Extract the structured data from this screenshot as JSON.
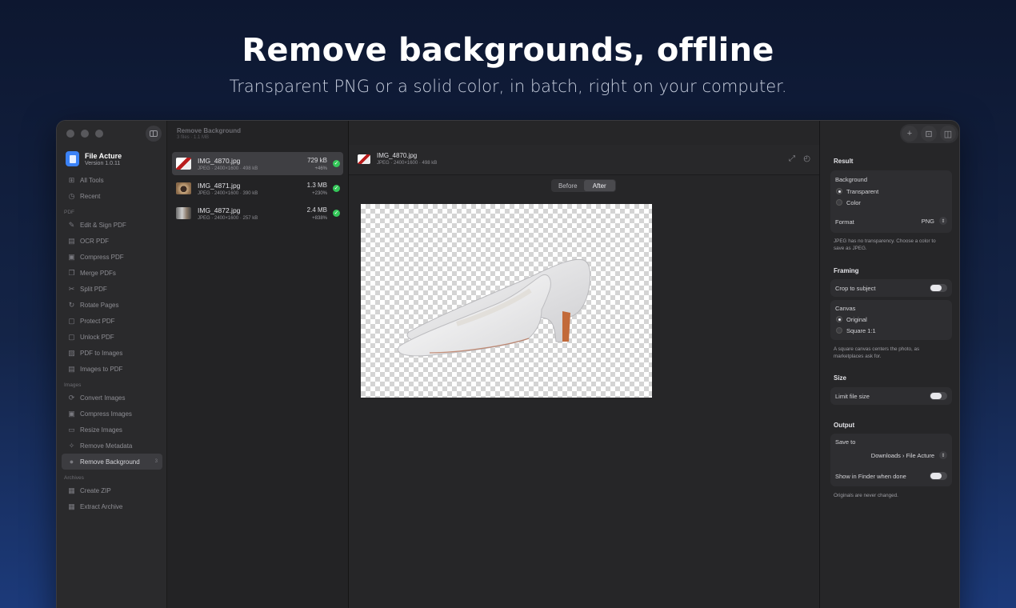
{
  "hero": {
    "title": "Remove backgrounds, offline",
    "subtitle": "Transparent PNG or a solid color, in batch, right on your computer."
  },
  "app": {
    "name": "File Acture",
    "version": "Version 1.0.11"
  },
  "sidebar": {
    "top": [
      {
        "label": "All Tools",
        "icon": "grid-icon"
      },
      {
        "label": "Recent",
        "icon": "clock-icon"
      }
    ],
    "pdf_section": "PDF",
    "pdf": [
      {
        "label": "Edit & Sign PDF"
      },
      {
        "label": "OCR PDF"
      },
      {
        "label": "Compress PDF"
      },
      {
        "label": "Merge PDFs"
      },
      {
        "label": "Split PDF"
      },
      {
        "label": "Rotate Pages"
      },
      {
        "label": "Protect PDF"
      },
      {
        "label": "Unlock PDF"
      },
      {
        "label": "PDF to Images"
      },
      {
        "label": "Images to PDF"
      }
    ],
    "images_section": "Images",
    "images": [
      {
        "label": "Convert Images"
      },
      {
        "label": "Compress Images"
      },
      {
        "label": "Resize Images"
      },
      {
        "label": "Remove Metadata"
      },
      {
        "label": "Remove Background",
        "count": "3"
      }
    ],
    "archives_section": "Archives",
    "archives": [
      {
        "label": "Create ZIP"
      },
      {
        "label": "Extract Archive"
      }
    ]
  },
  "filelist": {
    "title": "Remove Background",
    "subtitle": "3 files · 1.1 MB",
    "files": [
      {
        "name": "IMG_4870.jpg",
        "meta": "JPEG · 2400×1600 · 498 kB",
        "size": "729 kB",
        "delta": "+46%"
      },
      {
        "name": "IMG_4871.jpg",
        "meta": "JPEG · 2400×1600 · 390 kB",
        "size": "1.3 MB",
        "delta": "+230%"
      },
      {
        "name": "IMG_4872.jpg",
        "meta": "JPEG · 2400×1600 · 257 kB",
        "size": "2.4 MB",
        "delta": "+838%"
      }
    ]
  },
  "preview": {
    "name": "IMG_4870.jpg",
    "meta": "JPEG · 2400×1600 · 498 kB",
    "before_label": "Before",
    "after_label": "After",
    "active_tab": "After"
  },
  "inspector": {
    "result_title": "Result",
    "background_label": "Background",
    "bg_transparent": "Transparent",
    "bg_color": "Color",
    "format_label": "Format",
    "format_value": "PNG",
    "format_note": "JPEG has no transparency. Choose a color to save as JPEG.",
    "framing_title": "Framing",
    "crop_label": "Crop to subject",
    "canvas_label": "Canvas",
    "canvas_original": "Original",
    "canvas_square": "Square 1:1",
    "canvas_note": "A square canvas centers the photo, as marketplaces ask for.",
    "size_title": "Size",
    "limit_label": "Limit file size",
    "output_title": "Output",
    "save_to_label": "Save to",
    "save_to_value": "Downloads › File Acture",
    "show_finder_label": "Show in Finder when done",
    "originals_note": "Originals are never changed."
  },
  "colors": {
    "accent": "#3b82f6",
    "success": "#34c759",
    "window_bg": "#1e1e20"
  }
}
